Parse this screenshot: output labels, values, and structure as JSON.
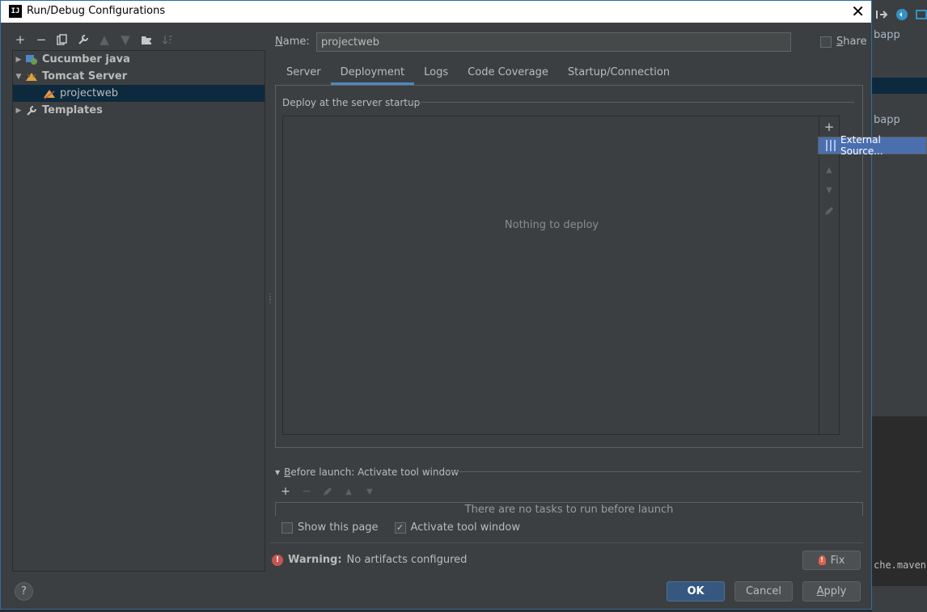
{
  "background_ide": {
    "text_webapp_1": "bapp",
    "text_webapp_2": "bapp",
    "console_text": "che.maven"
  },
  "dialog": {
    "title": "Run/Debug Configurations",
    "app_icon_text": "IJ",
    "close_glyph": "✕"
  },
  "toolbar": {
    "items": [
      "add",
      "remove",
      "copy",
      "edit-defaults",
      "move-up",
      "move-down",
      "new-folder",
      "sort"
    ]
  },
  "tree": {
    "items": [
      {
        "label": "Cucumber java",
        "icon": "cucumber-icon",
        "expanded": false
      },
      {
        "label": "Tomcat Server",
        "icon": "tomcat-icon",
        "expanded": true
      },
      {
        "label": "projectweb",
        "icon": "tomcat-config-icon",
        "selected": true
      },
      {
        "label": "Templates",
        "icon": "wrench-icon",
        "expanded": false
      }
    ]
  },
  "form": {
    "name_label_prefix": "N",
    "name_label_rest": "ame:",
    "name_value": "projectweb",
    "share_label_prefix": "S",
    "share_label_rest": "hare"
  },
  "tabs": {
    "items": [
      "Server",
      "Deployment",
      "Logs",
      "Code Coverage",
      "Startup/Connection"
    ],
    "active": "Deployment"
  },
  "deployment": {
    "header": "Deploy at the server startup",
    "empty_text": "Nothing to deploy",
    "popup_item": "External Source..."
  },
  "before_launch": {
    "label_prefix": "B",
    "label_rest": "efore launch: Activate tool window",
    "empty_text": "There are no tasks to run before launch",
    "show_this_page": "Show this page",
    "activate_tool_window": "Activate tool window"
  },
  "warning": {
    "label": "Warning:",
    "message": "No artifacts configured",
    "fix_label": "Fix"
  },
  "buttons": {
    "help": "?",
    "ok": "OK",
    "cancel": "Cancel",
    "apply_prefix": "A",
    "apply_rest": "pply"
  },
  "colors": {
    "accent": "#4a88c7",
    "selection": "#0d293e",
    "popup_highlight": "#4b6eaf",
    "error": "#c75450"
  }
}
